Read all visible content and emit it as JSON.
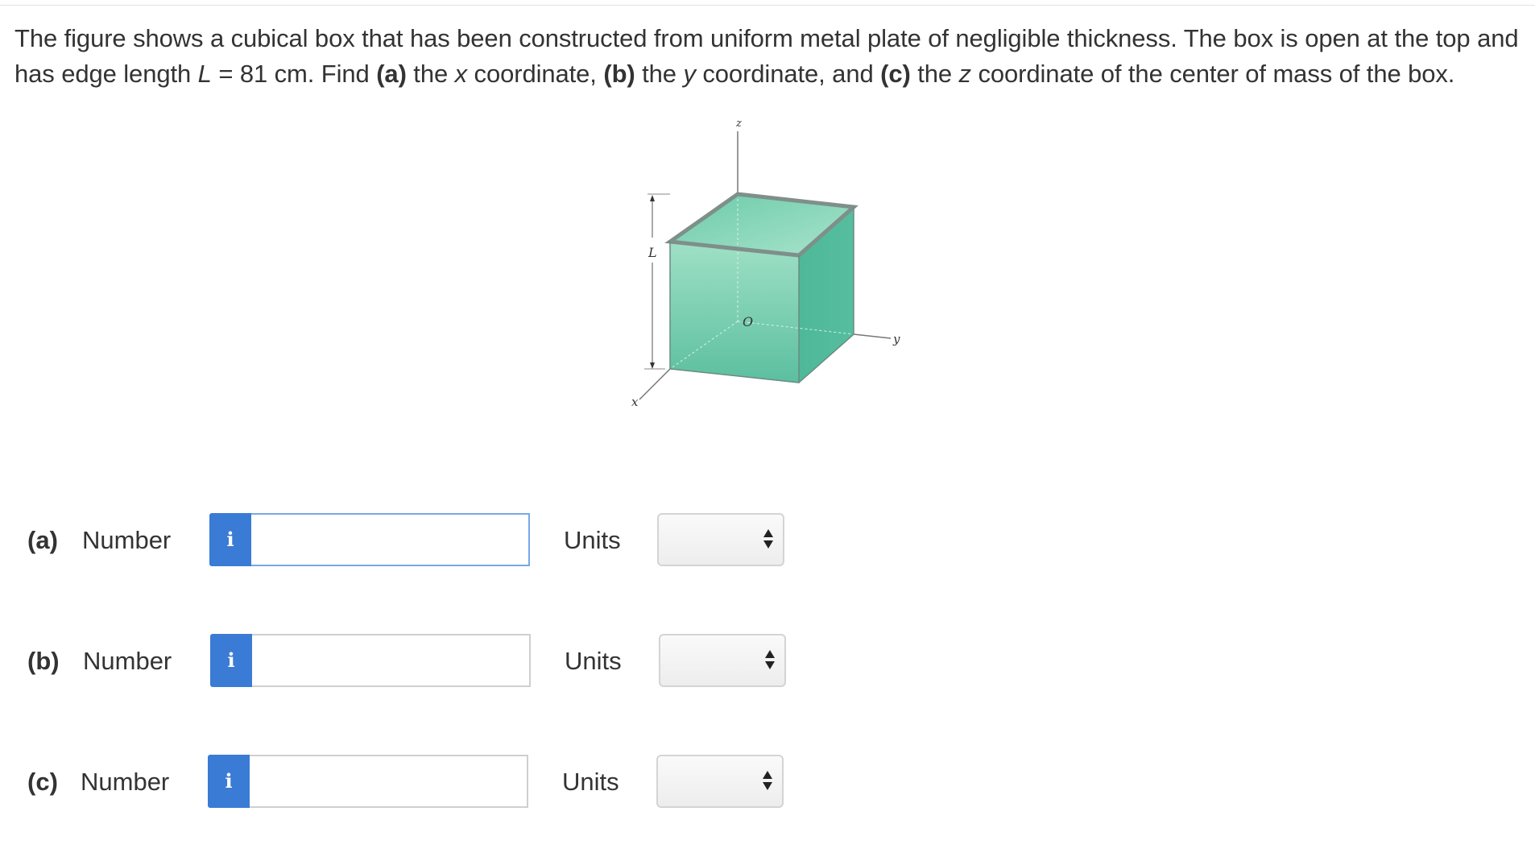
{
  "question": {
    "p1": "The figure shows a cubical box that has been constructed from uniform metal plate of negligible thickness. The box is open at the top and has edge length ",
    "L_symbol": "L",
    "p2": " = 81 cm. Find ",
    "a_marker": "(a)",
    "p3": " the ",
    "x_var": "x",
    "p4": " coordinate, ",
    "b_marker": "(b)",
    "p5": " the ",
    "y_var": "y",
    "p6": " coordinate, and ",
    "c_marker": "(c)",
    "p7": " the ",
    "z_var": "z",
    "p8": " coordinate of the center of mass of the box."
  },
  "figure": {
    "label_z": "z",
    "label_y": "y",
    "label_x": "x",
    "label_L": "L",
    "label_O": "O",
    "colors": {
      "cube_front": "#5fc2a4",
      "cube_side": "#4bb596",
      "cube_inner": "#8ad6bc",
      "rim": "#7f8f8a"
    }
  },
  "answers": [
    {
      "part": "(a)",
      "number_label": "Number",
      "info_icon": "i",
      "value": "",
      "units_label": "Units",
      "units_value": ""
    },
    {
      "part": "(b)",
      "number_label": "Number",
      "info_icon": "i",
      "value": "",
      "units_label": "Units",
      "units_value": ""
    },
    {
      "part": "(c)",
      "number_label": "Number",
      "info_icon": "i",
      "value": "",
      "units_label": "Units",
      "units_value": ""
    }
  ],
  "colors": {
    "info_button": "#3a7bd5",
    "focused_border": "#79a7e8",
    "text": "#333333"
  }
}
